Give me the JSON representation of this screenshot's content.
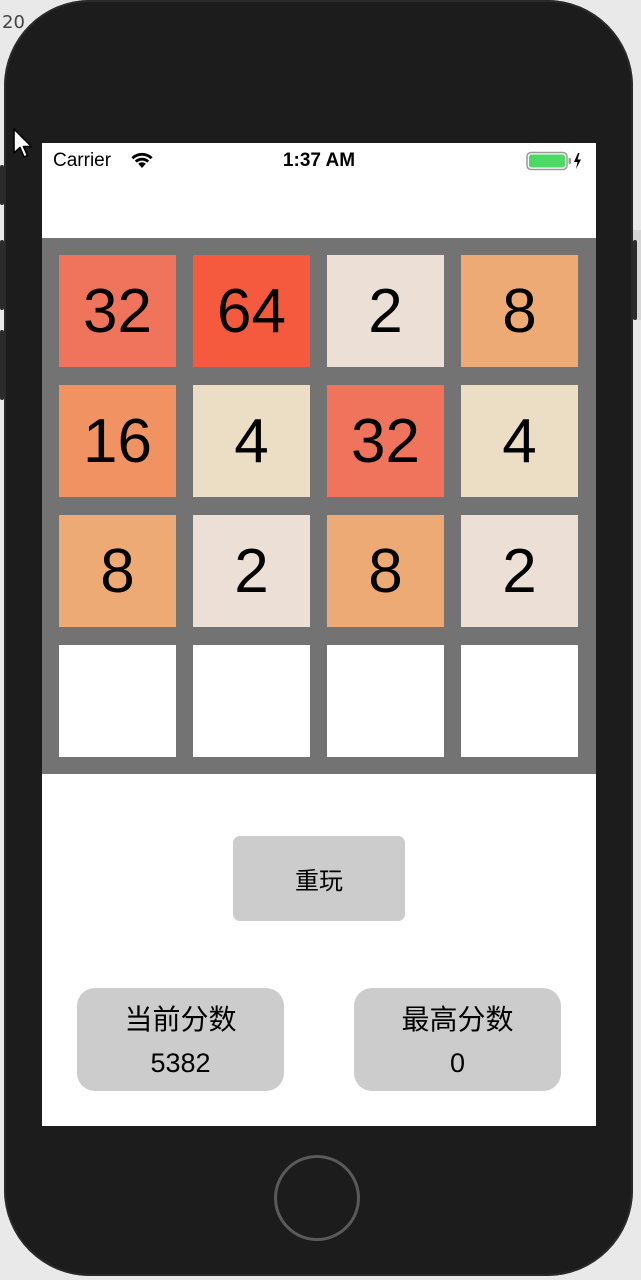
{
  "status_bar": {
    "carrier": "Carrier",
    "time": "1:37 AM",
    "wifi_icon": "wifi-icon",
    "battery_icon": "battery-icon",
    "battery_level": 1.0,
    "battery_color": "#4cd964"
  },
  "board": {
    "background": "#737373",
    "tiles": [
      [
        "32",
        "64",
        "2",
        "8"
      ],
      [
        "16",
        "4",
        "32",
        "4"
      ],
      [
        "8",
        "2",
        "8",
        "2"
      ],
      [
        "",
        "",
        "",
        ""
      ]
    ],
    "tile_colors": {
      "2": "#ece0d6",
      "4": "#ebdec5",
      "8": "#eeaa75",
      "16": "#f09262",
      "32": "#f0745c",
      "64": "#f55a3f",
      "empty": "#ffffff"
    }
  },
  "controls": {
    "replay_label": "重玩"
  },
  "scores": {
    "current_label": "当前分数",
    "current_value": "5382",
    "best_label": "最高分数",
    "best_value": "0"
  }
}
